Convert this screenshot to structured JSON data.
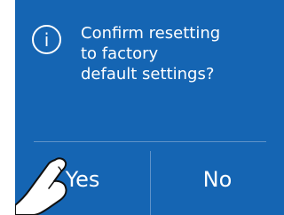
{
  "dialog": {
    "icon": "info-icon",
    "icon_glyph": "i",
    "message_lines": [
      "Confirm resetting",
      "to factory",
      "default settings?"
    ]
  },
  "buttons": {
    "yes_label": "Yes",
    "no_label": "No"
  },
  "colors": {
    "background": "#1565b3",
    "text": "#ffffff",
    "divider": "#5f93c9"
  }
}
